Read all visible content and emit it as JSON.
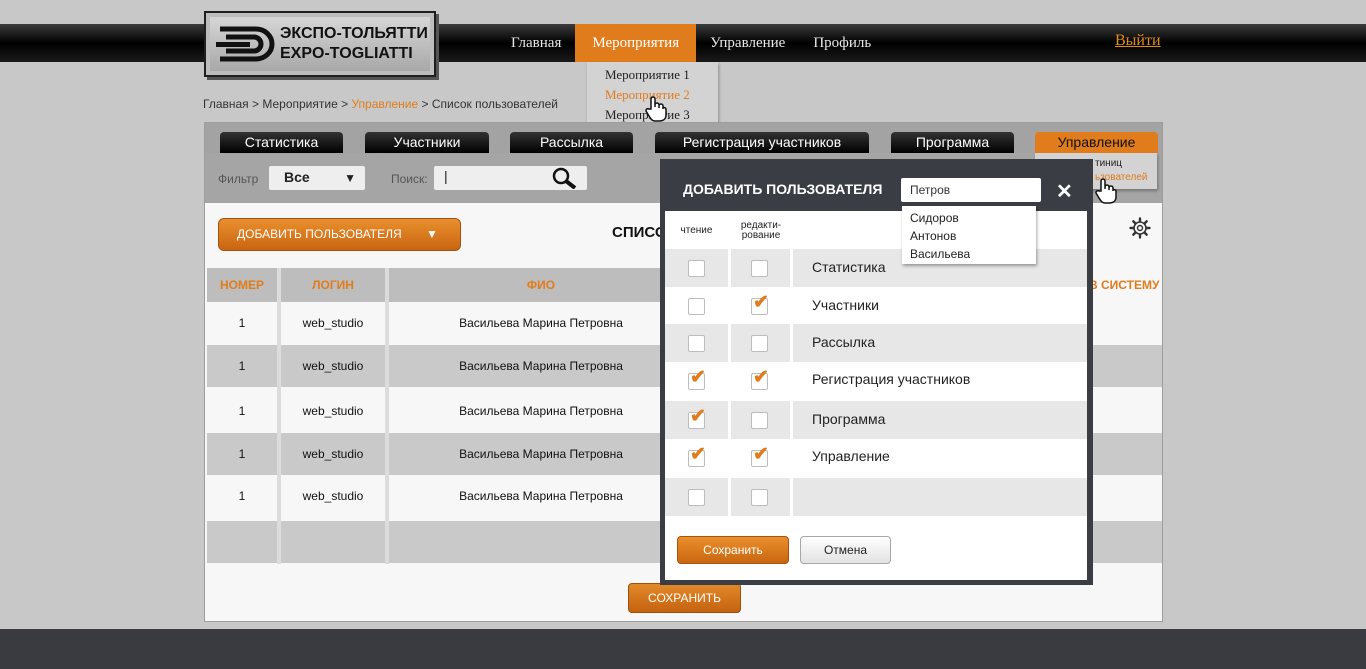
{
  "logo": {
    "line1": "ЭКСПО-ТОЛЬЯТТИ",
    "line2": "EXPO-TOGLIATTI"
  },
  "nav": {
    "items": [
      "Главная",
      "Мероприятия",
      "Управление",
      "Профиль"
    ],
    "logout": "Выйти",
    "dropdown": [
      "Мероприятие 1",
      "Мероприятие 2",
      "Мероприятие 3"
    ]
  },
  "breadcrumb": {
    "p1": "Главная > Мероприятие > ",
    "p2": "Управление",
    "p3": " > Список пользователей"
  },
  "tabs": [
    "Статистика",
    "Участники",
    "Рассылка",
    "Регистрация участников",
    "Программа",
    "Управление"
  ],
  "tab_dropdown": {
    "item1": "тиниц",
    "item2": "ьзователей"
  },
  "filter": {
    "label": "Фильтр",
    "value": "Все",
    "search_label": "Поиск:",
    "search_value": "|"
  },
  "toolbar": {
    "add_user": "ДОБАВИТЬ ПОЛЬЗОВАТЕЛЯ",
    "list_title": "СПИСО"
  },
  "table": {
    "headers": [
      "НОМЕР",
      "ЛОГИН",
      "ФИО"
    ],
    "right_header": "В СИСТЕМУ",
    "rows": [
      {
        "num": "1",
        "login": "web_studio",
        "name": "Васильева Марина Петровна"
      },
      {
        "num": "1",
        "login": "web_studio",
        "name": "Васильева Марина Петровна"
      },
      {
        "num": "1",
        "login": "web_studio",
        "name": "Васильева Марина Петровна"
      },
      {
        "num": "1",
        "login": "web_studio",
        "name": "Васильева Марина Петровна"
      },
      {
        "num": "1",
        "login": "web_studio",
        "name": "Васильева Марина Петровна"
      }
    ]
  },
  "save_label": "СОХРАНИТЬ",
  "modal": {
    "title": "ДОБАВИТЬ ПОЛЬЗОВАТЕЛЯ",
    "search_value": "Петров",
    "close": "✕",
    "suggestions": [
      "Сидоров",
      "Антонов",
      "Васильева"
    ],
    "col_read": "чтение",
    "col_edit_1": "редакти-",
    "col_edit_2": "рование",
    "permissions": [
      {
        "label": "Статистика",
        "read": false,
        "edit": false
      },
      {
        "label": "Участники",
        "read": false,
        "edit": true
      },
      {
        "label": "Рассылка",
        "read": false,
        "edit": false
      },
      {
        "label": "Регистрация участников",
        "read": true,
        "edit": true
      },
      {
        "label": "Программа",
        "read": true,
        "edit": false
      },
      {
        "label": "Управление",
        "read": true,
        "edit": true
      },
      {
        "label": "",
        "read": false,
        "edit": false
      }
    ],
    "save": "Сохранить",
    "cancel": "Отмена"
  },
  "colors": {
    "accent": "#e07c1c",
    "dark": "#3b3d45"
  }
}
